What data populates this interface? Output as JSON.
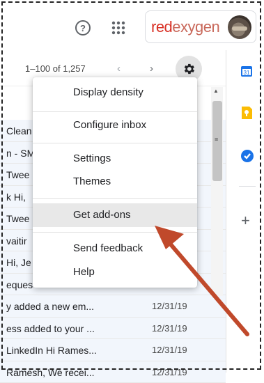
{
  "header": {
    "help_icon": "question-circle-icon",
    "apps_icon": "grid-apps-icon",
    "brand": {
      "part1": "red",
      "part2": "exygen",
      "colors": {
        "primary": "#d93025",
        "secondary": "#c9695b"
      }
    }
  },
  "toolbar": {
    "pager": "1–100 of 1,257",
    "prev": "‹",
    "next": "›",
    "settings_icon": "gear-icon"
  },
  "menu": {
    "items": [
      {
        "label": "Display density"
      },
      {
        "label": "Configure inbox"
      },
      {
        "label": "Settings"
      },
      {
        "label": "Themes"
      },
      {
        "label": "Get add-ons",
        "highlighted": true
      },
      {
        "label": "Send feedback"
      },
      {
        "label": "Help"
      }
    ]
  },
  "emails": [
    {
      "subject": "Clean",
      "date": ""
    },
    {
      "subject": "n - SM",
      "date": ""
    },
    {
      "subject": "Twee",
      "date": ""
    },
    {
      "subject": "k Hi,",
      "date": ""
    },
    {
      "subject": "Twee",
      "date": ""
    },
    {
      "subject": "vaitir",
      "date": ""
    },
    {
      "subject": "Hi, Je",
      "date": ""
    },
    {
      "subject": "eques",
      "date": ""
    },
    {
      "subject": "y added a new em...",
      "date": "12/31/19"
    },
    {
      "subject": "ess added to your ...",
      "date": "12/31/19"
    },
    {
      "subject": "LinkedIn Hi Rames...",
      "date": "12/31/19"
    },
    {
      "subject": "Ramesh, We recei...",
      "date": "12/31/19"
    }
  ],
  "side_rail": {
    "calendar_label": "31",
    "icons": [
      "calendar-icon",
      "keep-icon",
      "tasks-icon",
      "add-icon"
    ],
    "add": "+"
  },
  "colors": {
    "annotation_arrow": "#c0492b",
    "gear_bg": "#e2e2e2",
    "menu_hover": "#e8e8e8"
  }
}
